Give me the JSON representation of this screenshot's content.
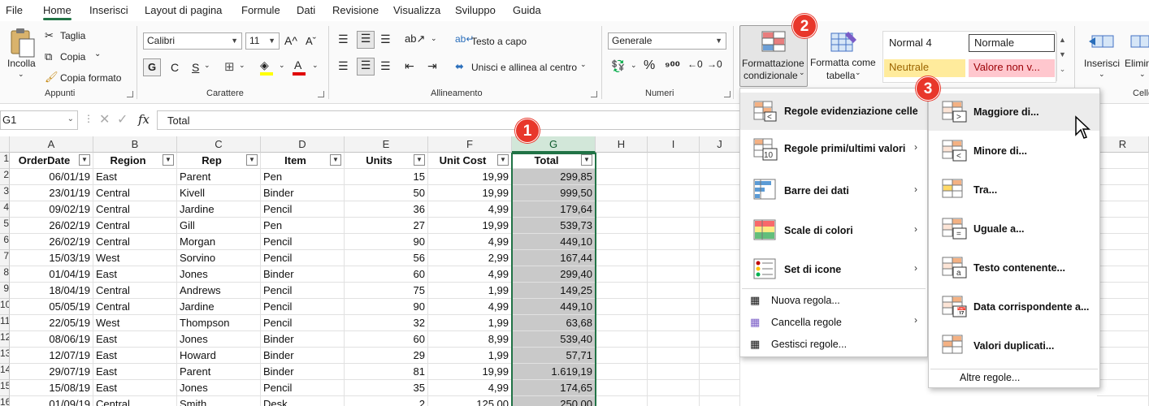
{
  "menubar": [
    "File",
    "Home",
    "Inserisci",
    "Layout di pagina",
    "Formule",
    "Dati",
    "Revisione",
    "Visualizza",
    "Sviluppo",
    "Guida"
  ],
  "ribbon": {
    "appunti": {
      "paste": "Incolla",
      "cut": "Taglia",
      "copy": "Copia",
      "format_painter": "Copia formato",
      "label": "Appunti"
    },
    "carattere": {
      "font": "Calibri",
      "size": "11",
      "bold": "G",
      "italic": "C",
      "underline": "S",
      "label": "Carattere"
    },
    "allineamento": {
      "wrap": "Testo a capo",
      "merge": "Unisci e allinea al centro",
      "label": "Allineamento"
    },
    "numeri": {
      "format": "Generale",
      "label": "Numeri"
    },
    "stili": {
      "conditional": [
        "Formattazione",
        "condizionale"
      ],
      "table": [
        "Formatta come",
        "tabella"
      ],
      "normal4": "Normal 4",
      "normale": "Normale",
      "neutrale": "Neutrale",
      "valore": "Valore non v...",
      "neutral_color": "#ffeb9c",
      "bad_color": "#ffc7ce"
    },
    "celle": {
      "insert": "Inserisci",
      "delete": "Elimin",
      "label": "Celle"
    }
  },
  "formula_bar": {
    "name_box": "G1",
    "formula": "Total"
  },
  "columns": [
    "A",
    "B",
    "C",
    "D",
    "E",
    "F",
    "G",
    "H",
    "I",
    "J",
    "R"
  ],
  "headers": [
    "OrderDate",
    "Region",
    "Rep",
    "Item",
    "Units",
    "Unit Cost",
    "Total"
  ],
  "rows": [
    [
      "06/01/19",
      "East",
      "Parent",
      "Pen",
      "15",
      "19,99",
      "299,85"
    ],
    [
      "23/01/19",
      "Central",
      "Kivell",
      "Binder",
      "50",
      "19,99",
      "999,50"
    ],
    [
      "09/02/19",
      "Central",
      "Jardine",
      "Pencil",
      "36",
      "4,99",
      "179,64"
    ],
    [
      "26/02/19",
      "Central",
      "Gill",
      "Pen",
      "27",
      "19,99",
      "539,73"
    ],
    [
      "26/02/19",
      "Central",
      "Morgan",
      "Pencil",
      "90",
      "4,99",
      "449,10"
    ],
    [
      "15/03/19",
      "West",
      "Sorvino",
      "Pencil",
      "56",
      "2,99",
      "167,44"
    ],
    [
      "01/04/19",
      "East",
      "Jones",
      "Binder",
      "60",
      "4,99",
      "299,40"
    ],
    [
      "18/04/19",
      "Central",
      "Andrews",
      "Pencil",
      "75",
      "1,99",
      "149,25"
    ],
    [
      "05/05/19",
      "Central",
      "Jardine",
      "Pencil",
      "90",
      "4,99",
      "449,10"
    ],
    [
      "22/05/19",
      "West",
      "Thompson",
      "Pencil",
      "32",
      "1,99",
      "63,68"
    ],
    [
      "08/06/19",
      "East",
      "Jones",
      "Binder",
      "60",
      "8,99",
      "539,40"
    ],
    [
      "12/07/19",
      "East",
      "Howard",
      "Binder",
      "29",
      "1,99",
      "57,71"
    ],
    [
      "29/07/19",
      "East",
      "Parent",
      "Binder",
      "81",
      "19,99",
      "1.619,19"
    ],
    [
      "15/08/19",
      "East",
      "Jones",
      "Pencil",
      "35",
      "4,99",
      "174,65"
    ],
    [
      "01/09/19",
      "Central",
      "Smith",
      "Desk",
      "2",
      "125,00",
      "250,00"
    ]
  ],
  "row_numbers": [
    "1",
    "2",
    "3",
    "4",
    "5",
    "6",
    "7",
    "8",
    "9",
    "10",
    "11",
    "12",
    "13",
    "14",
    "15",
    "16"
  ],
  "main_menu": {
    "items": [
      "Regole evidenziazione celle",
      "Regole primi/ultimi valori",
      "Barre dei dati",
      "Scale di colori",
      "Set di icone"
    ],
    "small_items": [
      "Nuova regola...",
      "Cancella regole",
      "Gestisci regole..."
    ]
  },
  "sub_menu": {
    "items": [
      "Maggiore di...",
      "Minore di...",
      "Tra...",
      "Uguale a...",
      "Testo contenente...",
      "Data corrispondente a...",
      "Valori duplicati..."
    ],
    "more": "Altre regole..."
  },
  "badges": [
    "1",
    "2",
    "3"
  ],
  "accent": "#217346",
  "badge_color": "#e8372b"
}
